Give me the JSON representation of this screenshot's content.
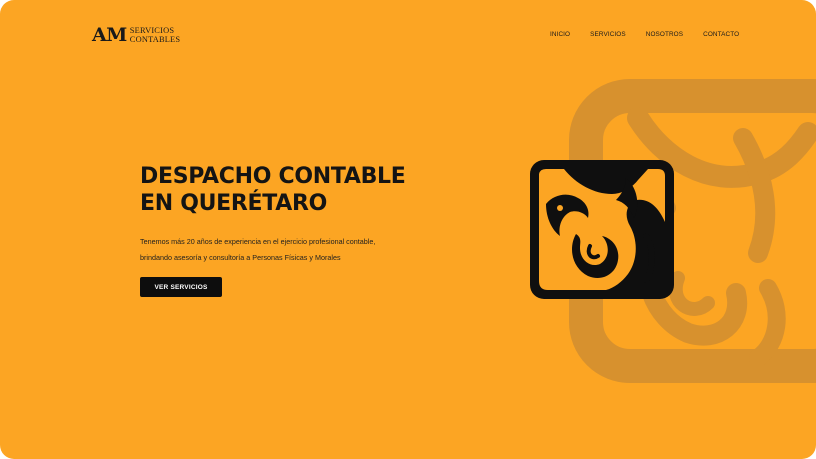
{
  "header": {
    "logo": {
      "mark": "AM",
      "line1": "SERVICIOS",
      "line2": "CONTABLES"
    },
    "nav": [
      {
        "label": "INICIO"
      },
      {
        "label": "SERVICIOS"
      },
      {
        "label": "NOSOTROS"
      },
      {
        "label": "CONTACTO"
      }
    ]
  },
  "hero": {
    "title_line1": "DESPACHO CONTABLE",
    "title_line2": "EN QUERÉTARO",
    "text_line1": "Tenemos más 20 años de experiencia en el ejercicio profesional contable,",
    "text_line2": "brindando asesoría y consultoría a Personas Físicas y Morales",
    "cta_label": "VER SERVICIOS"
  },
  "colors": {
    "background": "#fca523",
    "text": "#141414",
    "button": "#0d0d0d",
    "emblem_shadow": "#d7912e"
  },
  "icons": [
    "imss-emblem-icon",
    "imss-emblem-background-icon"
  ]
}
